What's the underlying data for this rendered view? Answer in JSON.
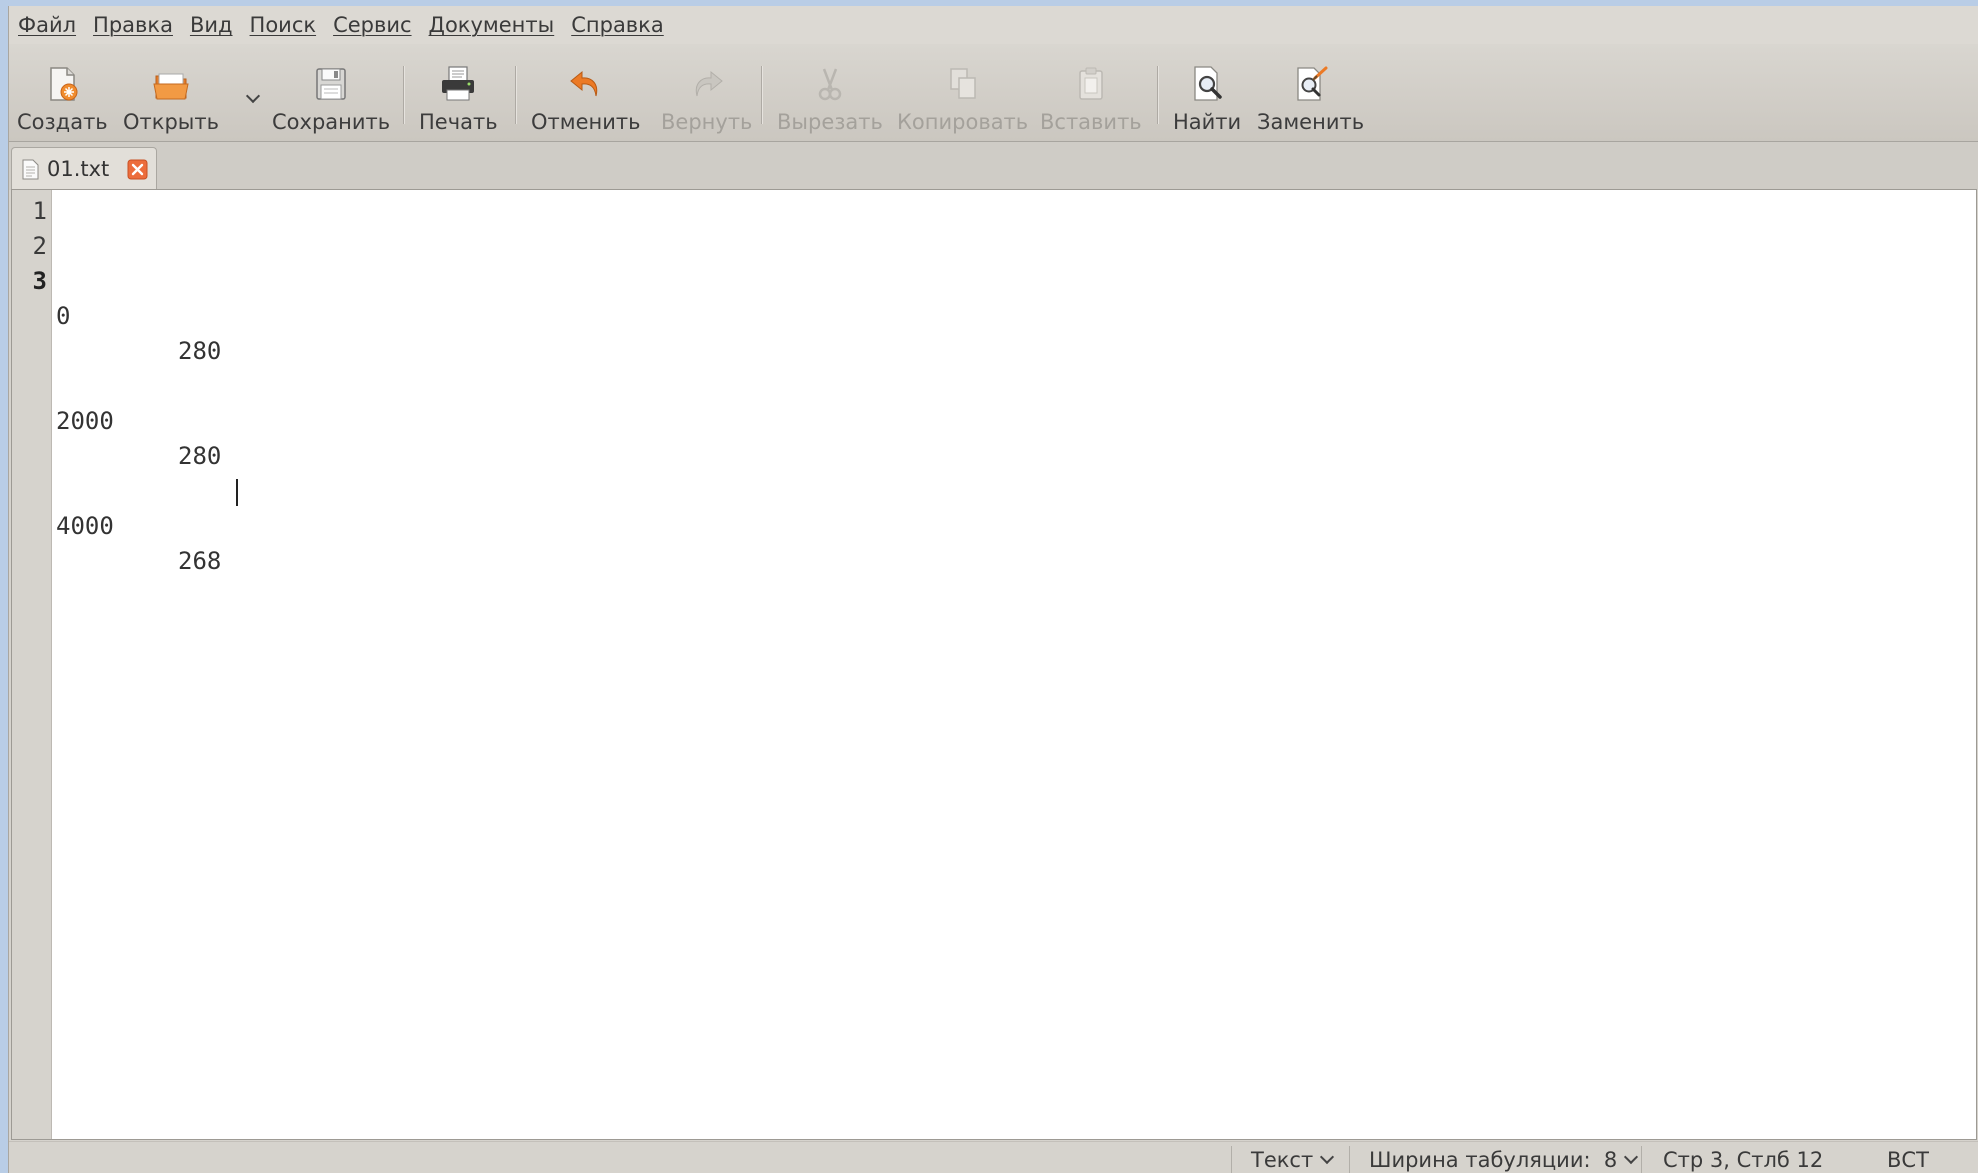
{
  "menubar": {
    "items": [
      "Файл",
      "Правка",
      "Вид",
      "Поиск",
      "Сервис",
      "Документы",
      "Справка"
    ]
  },
  "toolbar": {
    "create": {
      "label": "Создать",
      "icon": "new-document-icon"
    },
    "open": {
      "label": "Открыть",
      "icon": "folder-open-icon"
    },
    "open_dropdown": {
      "icon": "chevron-down-icon"
    },
    "save": {
      "label": "Сохранить",
      "icon": "floppy-disk-icon"
    },
    "print": {
      "label": "Печать",
      "icon": "printer-icon"
    },
    "undo": {
      "label": "Отменить",
      "icon": "undo-arrow-icon"
    },
    "redo": {
      "label": "Вернуть",
      "icon": "redo-arrow-icon",
      "disabled": true
    },
    "cut": {
      "label": "Вырезать",
      "icon": "scissors-icon",
      "disabled": true
    },
    "copy": {
      "label": "Копировать",
      "icon": "copy-icon",
      "disabled": true
    },
    "paste": {
      "label": "Вставить",
      "icon": "clipboard-icon",
      "disabled": true
    },
    "find": {
      "label": "Найти",
      "icon": "magnifier-icon"
    },
    "replace": {
      "label": "Заменить",
      "icon": "find-replace-icon"
    }
  },
  "tabs": [
    {
      "label": "01.txt",
      "icon": "text-file-icon",
      "close_icon": "close-icon"
    }
  ],
  "editor": {
    "line_numbers": [
      "1",
      "2",
      "3"
    ],
    "current_line": 3,
    "lines": [
      {
        "col1": "0",
        "col2": "280"
      },
      {
        "col1": "2000",
        "col2": "280"
      },
      {
        "col1": "4000",
        "col2": "268"
      }
    ]
  },
  "statusbar": {
    "language": "Текст",
    "tab_width": "Ширина табуляции:  8",
    "position": "Стр 3, Стлб 12",
    "mode": "ВСТ"
  },
  "colors": {
    "accent_orange": "#e8742a",
    "close_red": "#e8653a",
    "chrome": "#d6d3cd",
    "desktop": "#b9cde6"
  }
}
